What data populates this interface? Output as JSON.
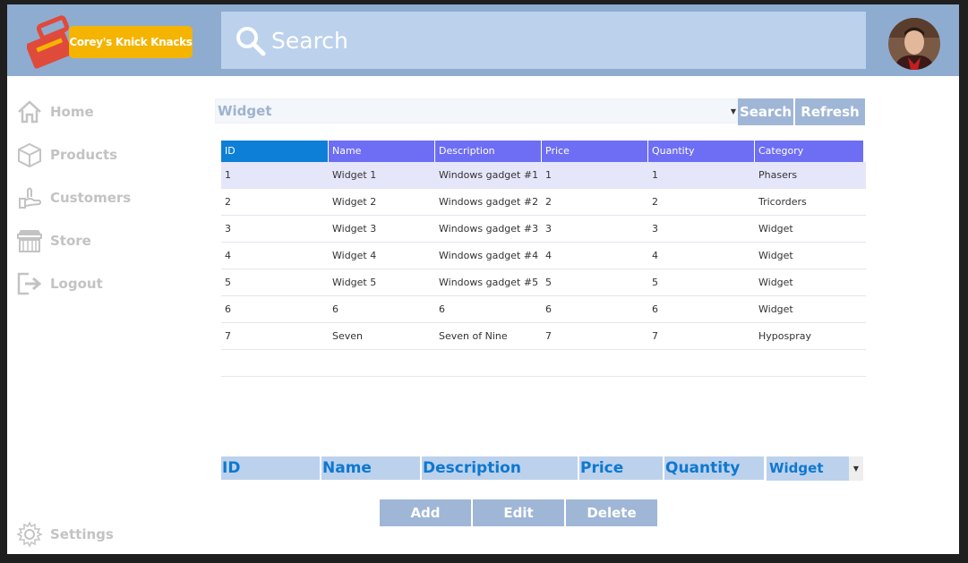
{
  "header": {
    "logo_text": "Corey's Knick Knacks",
    "search_label": "Search"
  },
  "sidebar": {
    "items": [
      {
        "label": "Home",
        "icon": "home-icon"
      },
      {
        "label": "Products",
        "icon": "box-icon"
      },
      {
        "label": "Customers",
        "icon": "hand-icon"
      },
      {
        "label": "Store",
        "icon": "store-icon"
      },
      {
        "label": "Logout",
        "icon": "logout-icon"
      }
    ],
    "settings_label": "Settings"
  },
  "filter": {
    "category_value": "Widget",
    "search_button": "Search",
    "refresh_button": "Refresh"
  },
  "table": {
    "columns": [
      "ID",
      "Name",
      "Description",
      "Price",
      "Quantity",
      "Category"
    ],
    "rows": [
      [
        "1",
        "Widget 1",
        "Windows gadget #1",
        "1",
        "1",
        "Phasers"
      ],
      [
        "2",
        "Widget 2",
        "Windows gadget #2",
        "2",
        "2",
        "Tricorders"
      ],
      [
        "3",
        "Widget 3",
        "Windows gadget #3",
        "3",
        "3",
        "Widget"
      ],
      [
        "4",
        "Widget 4",
        "Windows gadget #4",
        "4",
        "4",
        "Widget"
      ],
      [
        "5",
        "Widget 5",
        "Windows gadget #5",
        "5",
        "5",
        "Widget"
      ],
      [
        "6",
        "6",
        "6",
        "6",
        "6",
        "Widget"
      ],
      [
        "7",
        "Seven",
        "Seven of Nine",
        "7",
        "7",
        "Hypospray"
      ]
    ]
  },
  "editor": {
    "id_field": "ID",
    "name_field": "Name",
    "description_field": "Description",
    "price_field": "Price",
    "quantity_field": "Quantity",
    "category_value": "Widget",
    "add_button": "Add",
    "edit_button": "Edit",
    "delete_button": "Delete"
  },
  "colors": {
    "header_bg": "#8eacd0",
    "accent_blue": "#0e78d0",
    "table_header": "#6e6ef5",
    "logo_badge": "#f4b400"
  }
}
